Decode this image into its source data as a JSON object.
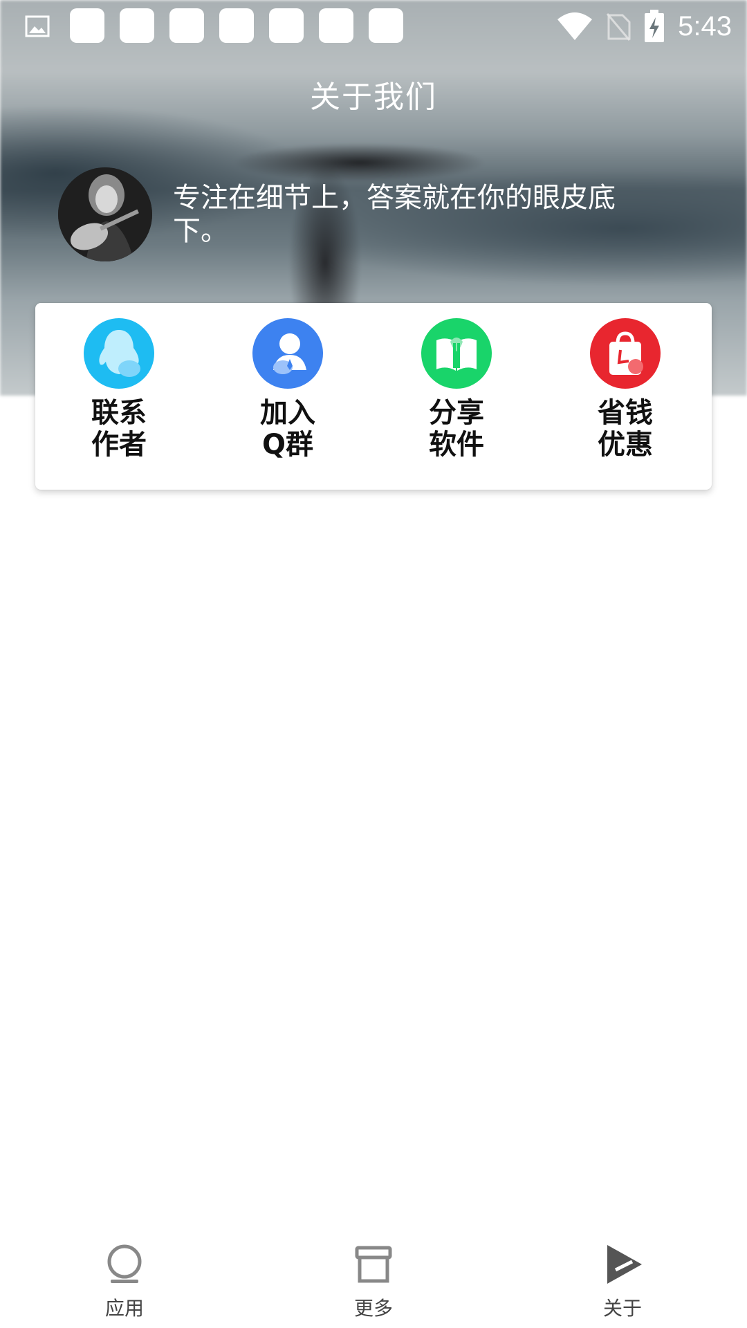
{
  "status_bar": {
    "time": "5:43",
    "icons": [
      "image-icon",
      "notification-square-icon",
      "wifi-icon",
      "no-sim-icon",
      "battery-charging-icon"
    ]
  },
  "header": {
    "title": "关于我们",
    "tagline": "专注在细节上，答案就在你的眼皮底下。"
  },
  "actions": [
    {
      "label": "联系\n作者",
      "icon": "qq-penguin-icon",
      "color": "#1ebcf2"
    },
    {
      "label": "加入\nQ群",
      "icon": "user-group-icon",
      "color": "#3d82f0"
    },
    {
      "label": "分享\n软件",
      "icon": "book-icon",
      "color": "#19d46a"
    },
    {
      "label": "省钱\n优惠",
      "icon": "shopping-bag-icon",
      "color": "#e8262f"
    }
  ],
  "bottom_nav": {
    "items": [
      {
        "label": "应用",
        "icon": "app-circle-icon"
      },
      {
        "label": "更多",
        "icon": "archive-box-icon"
      },
      {
        "label": "关于",
        "icon": "send-arrow-icon",
        "selected": true
      }
    ]
  }
}
